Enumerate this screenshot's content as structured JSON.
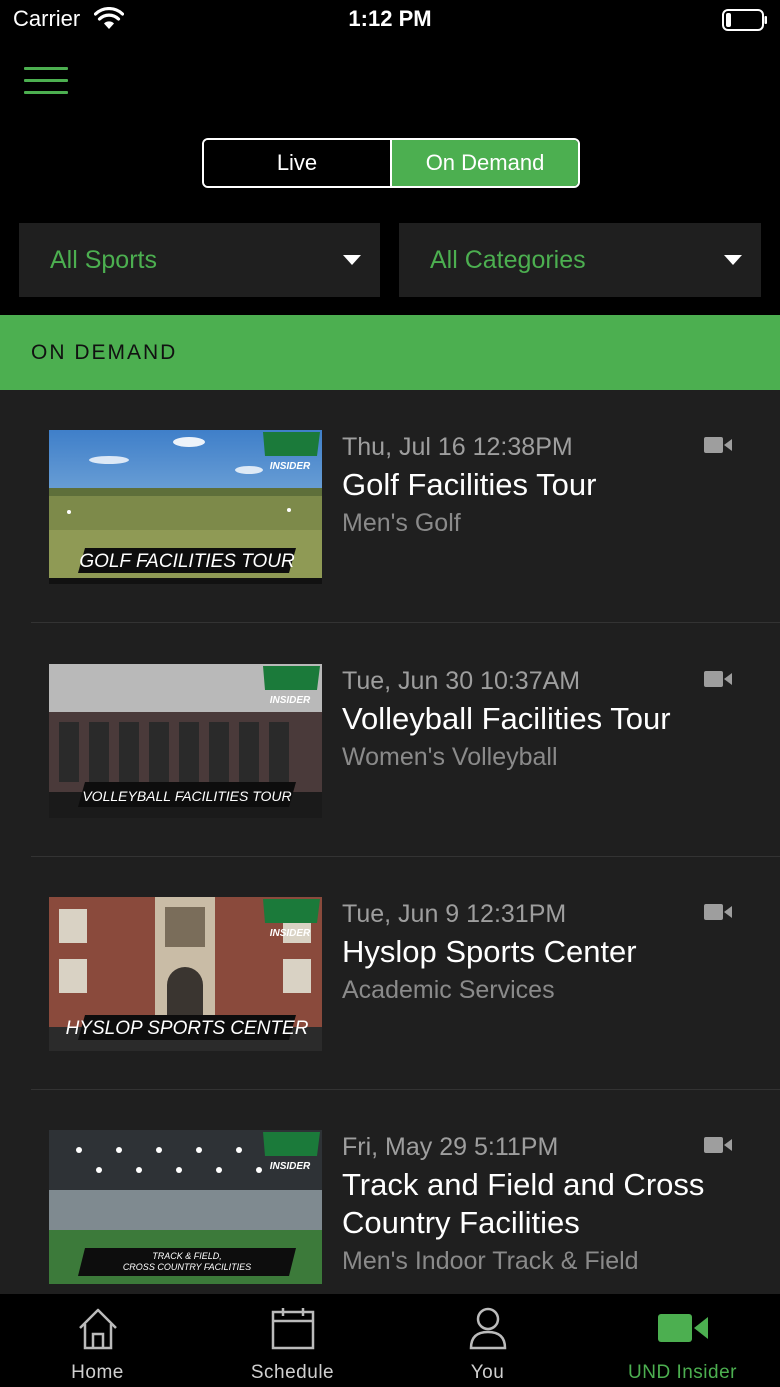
{
  "status_bar": {
    "carrier": "Carrier",
    "time": "1:12 PM"
  },
  "segments": {
    "live": "Live",
    "on_demand": "On Demand",
    "selected": "On Demand"
  },
  "filters": {
    "sports": "All Sports",
    "categories": "All Categories"
  },
  "section": {
    "title": "ON DEMAND"
  },
  "items": [
    {
      "date": "Thu, Jul 16 12:38PM",
      "title": "Golf Facilities Tour",
      "category": "Men's Golf",
      "thumb_caption": "GOLF FACILITIES TOUR",
      "badge": "INSIDER"
    },
    {
      "date": "Tue, Jun 30 10:37AM",
      "title": "Volleyball Facilities Tour",
      "category": "Women's Volleyball",
      "thumb_caption": "VOLLEYBALL FACILITIES TOUR",
      "badge": "INSIDER"
    },
    {
      "date": "Tue, Jun 9 12:31PM",
      "title": "Hyslop Sports Center",
      "category": "Academic Services",
      "thumb_caption": "HYSLOP SPORTS CENTER",
      "badge": "INSIDER"
    },
    {
      "date": "Fri, May 29 5:11PM",
      "title": "Track and Field and Cross Country Facilities",
      "category": "Men's Indoor Track & Field",
      "thumb_caption": "TRACK & FIELD, CROSS COUNTRY FACILITIES",
      "badge": "INSIDER"
    }
  ],
  "tabs": [
    {
      "label": "Home",
      "icon": "home-icon"
    },
    {
      "label": "Schedule",
      "icon": "calendar-icon"
    },
    {
      "label": "You",
      "icon": "person-icon"
    },
    {
      "label": "UND Insider",
      "icon": "video-camera-icon",
      "active": true
    }
  ],
  "colors": {
    "accent": "#4caf50",
    "background": "#1f1f1f",
    "bar": "#000000"
  }
}
